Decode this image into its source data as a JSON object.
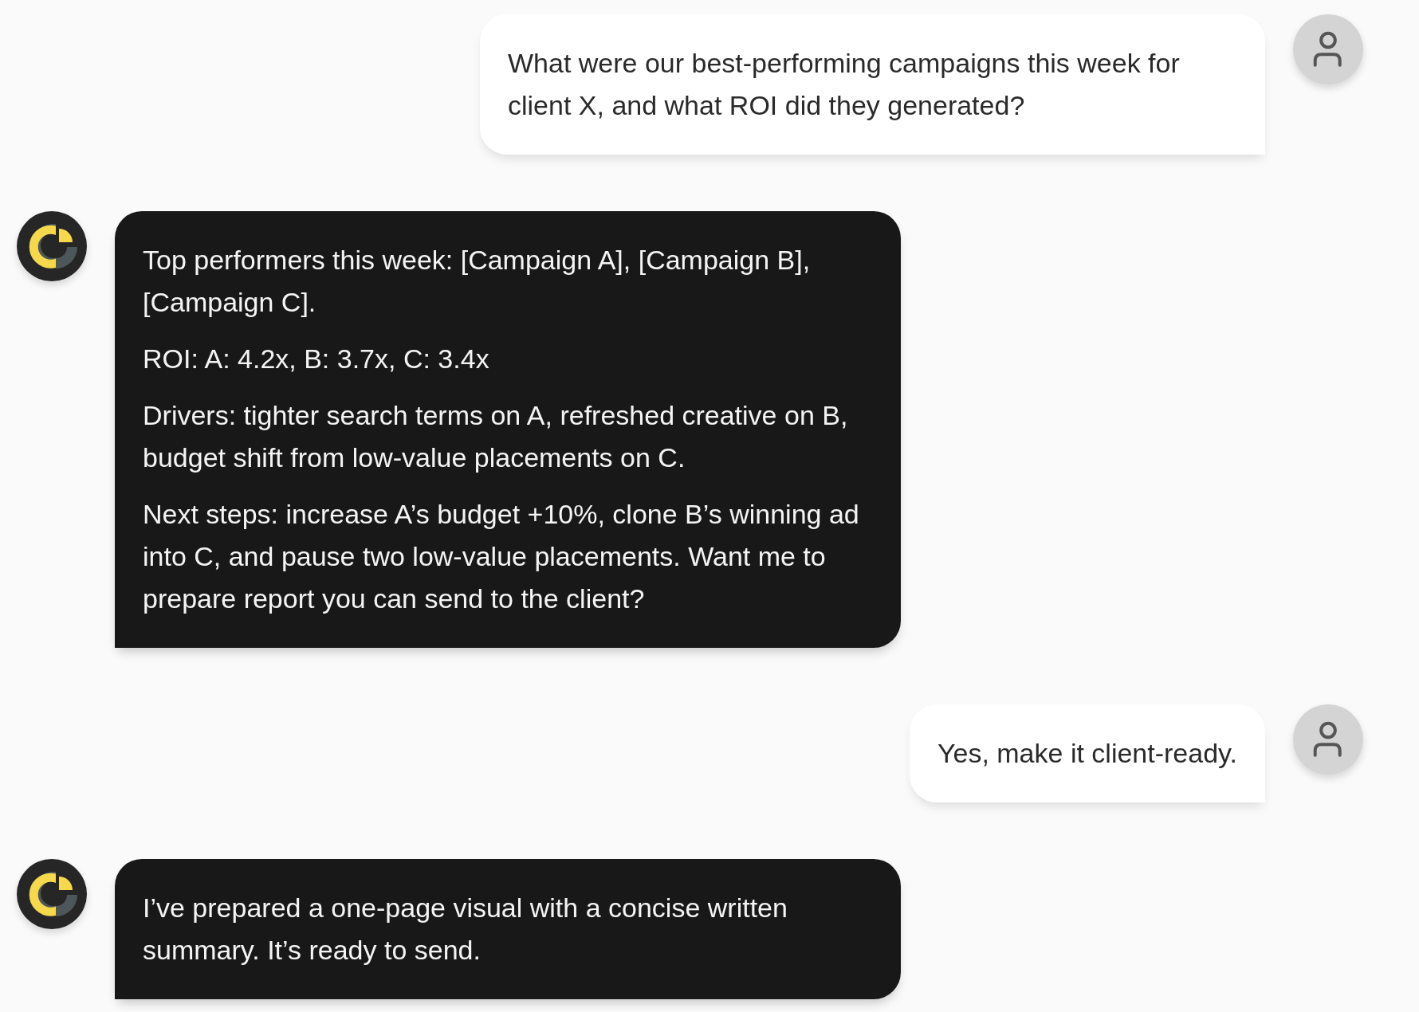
{
  "messages": [
    {
      "kind": "user",
      "paragraphs": [
        "What were our best-performing campaigns this week for client X, and what ROI did they generated?"
      ]
    },
    {
      "kind": "assistant",
      "paragraphs": [
        "Top performers this week: [Campaign A], [Campaign B], [Campaign C].",
        "ROI: A: 4.2x, B: 3.7x, C: 3.4x",
        "Drivers: tighter search terms on A, refreshed creative on B, budget shift from low-value placements on C.",
        "Next steps: increase A’s budget +10%, clone B’s winning ad into C, and pause two low-value placements. Want me to prepare report you can send to the client?"
      ]
    },
    {
      "kind": "user",
      "paragraphs": [
        "Yes, make it client-ready."
      ]
    },
    {
      "kind": "assistant",
      "paragraphs": [
        "I’ve prepared a one-page visual with a concise written summary. It’s ready to send."
      ]
    }
  ]
}
